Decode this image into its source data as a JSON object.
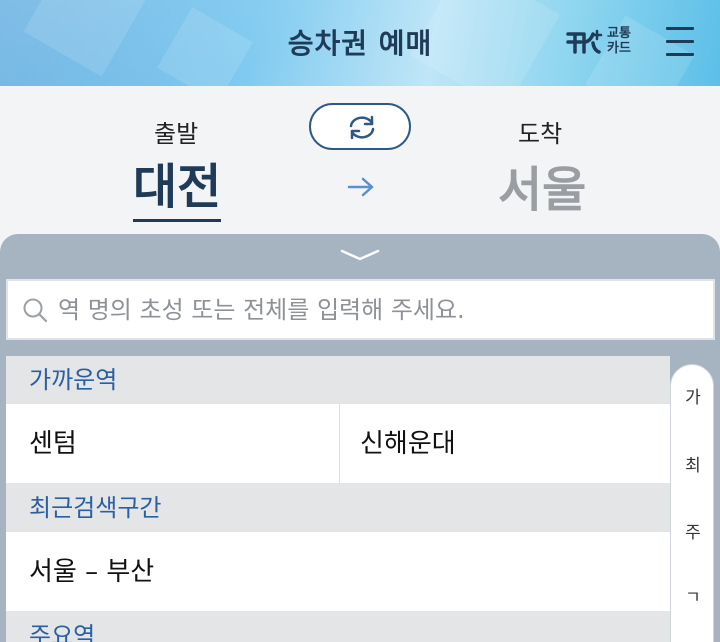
{
  "header": {
    "title": "승차권 예매",
    "card_logo_line1": "교통",
    "card_logo_line2": "카드",
    "menu_icon": "hamburger-menu-icon"
  },
  "route": {
    "departure_label": "출발",
    "arrival_label": "도착",
    "departure_city": "대전",
    "arrival_city": "서울",
    "swap_icon": "swap-arrows-icon",
    "arrow_icon": "right-arrow-icon"
  },
  "sheet": {
    "collapse_icon": "chevron-down-icon",
    "search_placeholder": "역 명의 초성 또는 전체를 입력해 주세요.",
    "search_value": "",
    "sections": [
      {
        "title": "가까운역",
        "items": [
          "센텀",
          "신해운대"
        ]
      },
      {
        "title": "최근검색구간",
        "items": [
          "서울 – 부산"
        ]
      },
      {
        "title": "주요역",
        "items": []
      }
    ],
    "index_letters": [
      "가",
      "최",
      "주",
      "ㄱ"
    ]
  },
  "colors": {
    "brand_navy": "#1f3b57",
    "section_blue": "#2a5fa0",
    "sheet_bg": "#a6b3c1",
    "arrow_blue": "#5b8fd0",
    "inactive_gray": "#9a9da1"
  }
}
